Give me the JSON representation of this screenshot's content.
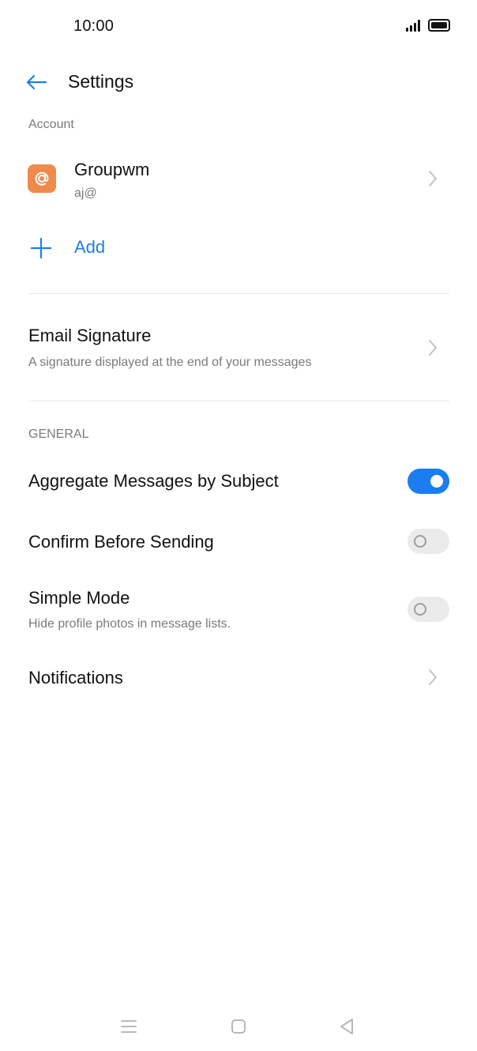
{
  "status_bar": {
    "time": "10:00",
    "signal_icon": "signal-icon",
    "battery_icon": "battery-icon"
  },
  "header": {
    "title": "Settings",
    "back_icon": "back-arrow-icon"
  },
  "account_section": {
    "header": "Account",
    "account": {
      "name": "Groupwm",
      "email": "aj@",
      "icon": "at-sign-icon"
    },
    "add_label": "Add"
  },
  "signature": {
    "title": "Email Signature",
    "subtitle": "A signature displayed at the end of your messages"
  },
  "general_section": {
    "header": "GENERAL",
    "items": [
      {
        "title": "Aggregate Messages by Subject",
        "toggle_on": true
      },
      {
        "title": "Confirm Before Sending",
        "toggle_on": false
      },
      {
        "title": "Simple Mode",
        "subtitle": "Hide profile photos in message lists.",
        "toggle_on": false
      }
    ],
    "notifications": {
      "title": "Notifications"
    }
  },
  "nav_bar": {
    "menu_icon": "menu-icon",
    "home_icon": "home-icon",
    "back_icon": "back-triangle-icon"
  },
  "colors": {
    "accent": "#1E7FE5",
    "toggle_on": "#1A7EF0",
    "avatar": "#EF8A4A",
    "secondary_text": "#7A7A7A"
  }
}
